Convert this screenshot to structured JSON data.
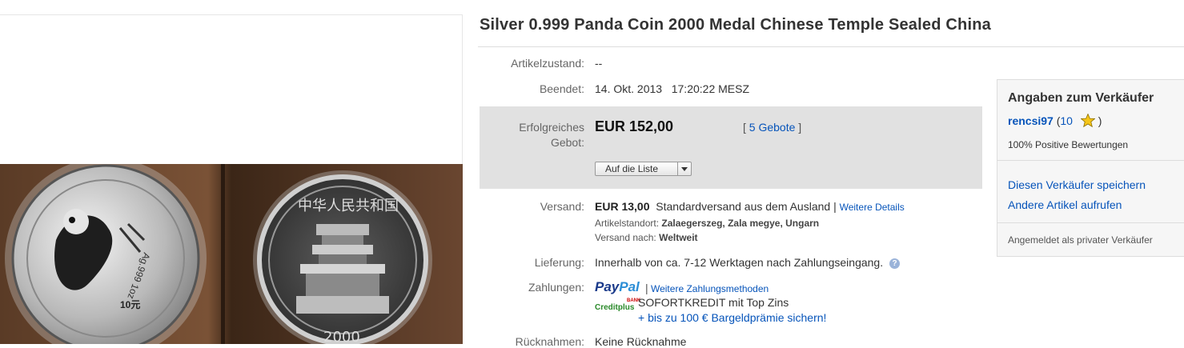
{
  "listing": {
    "title": "Silver 0.999 Panda Coin 2000 Medal Chinese Temple Sealed China"
  },
  "details": {
    "condition": {
      "label": "Artikelzustand:",
      "value": "--"
    },
    "ended": {
      "label": "Beendet:",
      "value": "14. Okt. 2013",
      "time": "17:20:22 MESZ"
    },
    "bid": {
      "label_line1": "Erfolgreiches",
      "label_line2": "Gebot:",
      "price": "EUR 152,00",
      "bids_open": "[",
      "bids_link": "5 Gebote",
      "bids_close": "]",
      "watch_button": "Auf die Liste"
    },
    "shipping": {
      "label": "Versand:",
      "price": "EUR 13,00",
      "method": "Standardversand aus dem Ausland |",
      "details_link": "Weitere Details",
      "location_label": "Artikelstandort:",
      "location_value": "Zalaegerszeg, Zala megye, Ungarn",
      "ships_to_label": "Versand nach:",
      "ships_to_value": "Weltweit"
    },
    "delivery": {
      "label": "Lieferung:",
      "value": "Innerhalb von ca. 7-12 Werktagen nach Zahlungseingang."
    },
    "payments": {
      "label": "Zahlungen:",
      "paypal_part1": "Pay",
      "paypal_part2": "Pal",
      "separator": "|",
      "more_link": "Weitere Zahlungsmethoden",
      "creditplus_logo": "Creditplus",
      "creditplus_badge": "BANK",
      "credit_text": "SOFORTKREDIT mit Top Zins",
      "credit_link": "+ bis zu 100 € Bargeldprämie sichern!"
    },
    "returns": {
      "label": "Rücknahmen:",
      "value": "Keine Rücknahme"
    }
  },
  "seller": {
    "heading": "Angaben zum Verkäufer",
    "name": "rencsi97",
    "score_open": "(",
    "score": "10",
    "score_close": ")",
    "positive": "100% Positive Bewertungen",
    "save_link": "Diesen Verkäufer speichern",
    "other_items_link": "Andere Artikel aufrufen",
    "registered": "Angemeldet als privater Verkäufer"
  },
  "photo": {
    "left_coin_value": "10元",
    "left_coin_weight": "Ag.999 1oz",
    "right_coin_year": "2000",
    "right_coin_legend": "中华人民共和国"
  },
  "colors": {
    "link": "#0654ba",
    "bid_box": "#e1e1e1",
    "star": "#f5c518"
  }
}
